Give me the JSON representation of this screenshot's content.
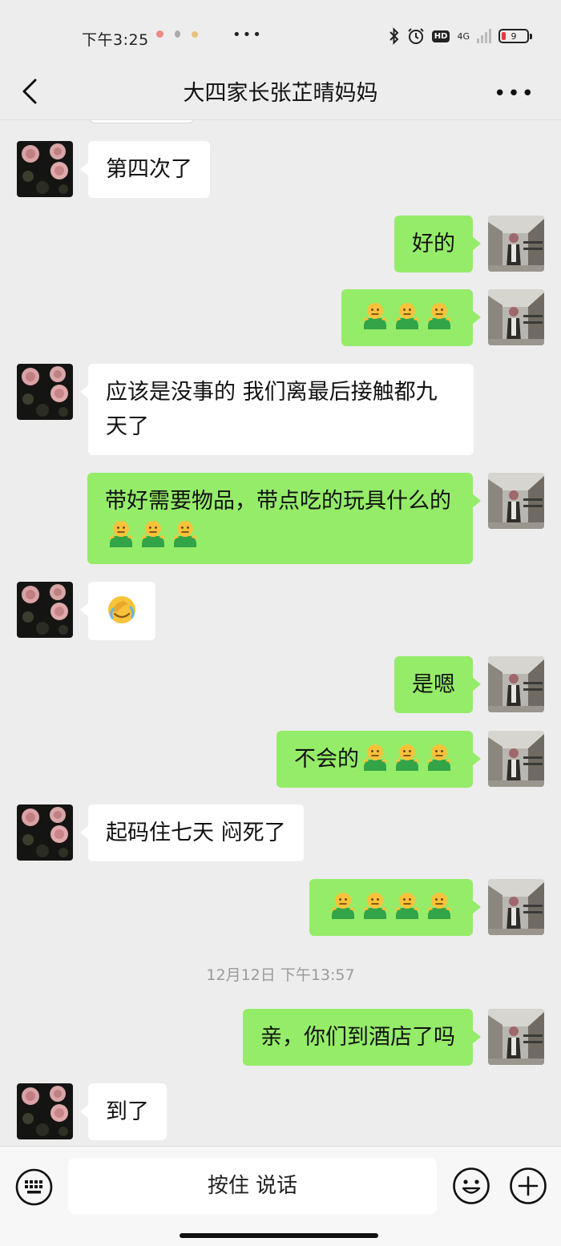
{
  "status_bar": {
    "time": "下午3:25",
    "network": "4G",
    "battery": "9"
  },
  "nav": {
    "title": "大四家长张芷晴妈妈"
  },
  "colors": {
    "outgoing_bubble": "#95ec69",
    "incoming_bubble": "#ffffff",
    "background": "#ededed"
  },
  "messages": [
    {
      "side": "in",
      "text": "第四次了"
    },
    {
      "side": "out",
      "text": "好的"
    },
    {
      "side": "out",
      "text": "",
      "emoji": [
        "shrug",
        "shrug",
        "shrug"
      ]
    },
    {
      "side": "in",
      "text": "应该是没事的 我们离最后接触都九天了"
    },
    {
      "side": "out",
      "text": "带好需要物品，带点吃的玩具什么的",
      "emoji": [
        "shrug",
        "shrug",
        "shrug"
      ]
    },
    {
      "side": "in",
      "text": "",
      "emoji": [
        "facepalm-cry"
      ]
    },
    {
      "side": "out",
      "text": "是嗯"
    },
    {
      "side": "out",
      "text": "不会的",
      "emoji": [
        "shrug",
        "shrug",
        "shrug"
      ]
    },
    {
      "side": "in",
      "text": "起码住七天 闷死了"
    },
    {
      "side": "out",
      "text": "",
      "emoji": [
        "shrug",
        "shrug",
        "shrug",
        "shrug"
      ]
    },
    {
      "side": "out",
      "text": "亲，你们到酒店了吗"
    },
    {
      "side": "in",
      "text": "到了"
    }
  ],
  "timestamp": "12月12日 下午13:57",
  "input_bar": {
    "voice_label": "按住 说话"
  }
}
